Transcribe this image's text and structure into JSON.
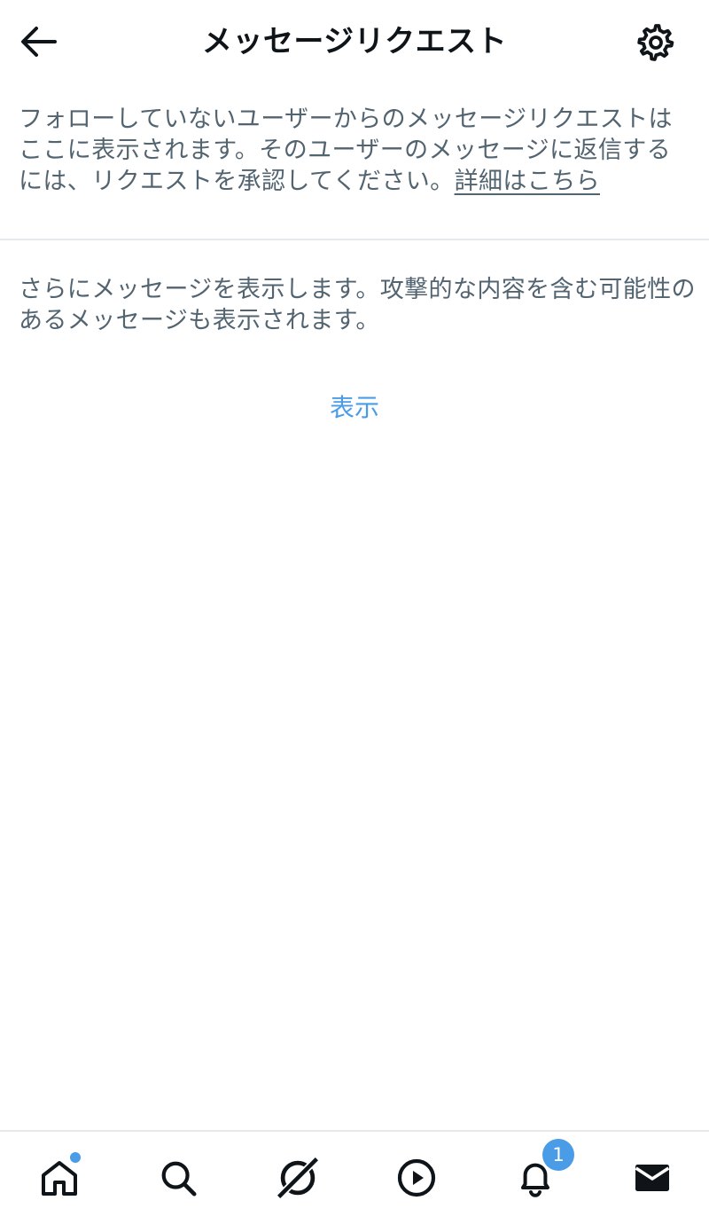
{
  "header": {
    "title": "メッセージリクエスト",
    "back_icon": "back-arrow-icon",
    "settings_icon": "gear-icon"
  },
  "info": {
    "text": "フォローしていないユーザーからのメッセージリクエストはここに表示されます。そのユーザーのメッセージに返信するには、リクエストを承認してください。",
    "learn_more": "詳細はこちら"
  },
  "more_messages": {
    "text": "さらにメッセージを表示します。攻撃的な内容を含む可能性のあるメッセージも表示されます。",
    "show_label": "表示"
  },
  "bottom_nav": {
    "items": [
      {
        "icon": "home-icon",
        "has_dot": true
      },
      {
        "icon": "search-icon"
      },
      {
        "icon": "spaces-icon"
      },
      {
        "icon": "play-icon"
      },
      {
        "icon": "bell-icon",
        "badge": "1"
      },
      {
        "icon": "mail-icon",
        "active": true
      }
    ]
  },
  "colors": {
    "accent": "#4a9ce6",
    "text_primary": "#0f1419",
    "text_secondary": "#536471",
    "divider": "#e6e9eb"
  }
}
